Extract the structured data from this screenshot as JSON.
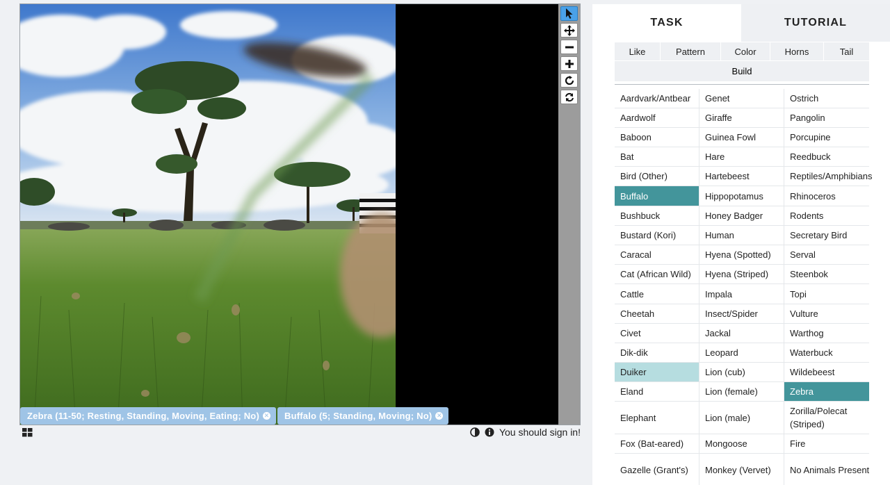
{
  "tags": [
    {
      "label": "Zebra (11-50; Resting, Standing, Moving, Eating; No)"
    },
    {
      "label": "Buffalo (5; Standing, Moving; No)"
    }
  ],
  "status": {
    "sign_in": "You should sign in!"
  },
  "tabs": {
    "task": "TASK",
    "tutorial": "TUTORIAL"
  },
  "filters": {
    "like": "Like",
    "pattern": "Pattern",
    "color": "Color",
    "horns": "Horns",
    "tail": "Tail",
    "build": "Build"
  },
  "species_rows": [
    [
      "Aardvark/Antbear",
      "Genet",
      "Ostrich"
    ],
    [
      "Aardwolf",
      "Giraffe",
      "Pangolin"
    ],
    [
      "Baboon",
      "Guinea Fowl",
      "Porcupine"
    ],
    [
      "Bat",
      "Hare",
      "Reedbuck"
    ],
    [
      "Bird (Other)",
      "Hartebeest",
      "Reptiles/Amphibians"
    ],
    [
      "Buffalo",
      "Hippopotamus",
      "Rhinoceros"
    ],
    [
      "Bushbuck",
      "Honey Badger",
      "Rodents"
    ],
    [
      "Bustard (Kori)",
      "Human",
      "Secretary Bird"
    ],
    [
      "Caracal",
      "Hyena (Spotted)",
      "Serval"
    ],
    [
      "Cat (African Wild)",
      "Hyena (Striped)",
      "Steenbok"
    ],
    [
      "Cattle",
      "Impala",
      "Topi"
    ],
    [
      "Cheetah",
      "Insect/Spider",
      "Vulture"
    ],
    [
      "Civet",
      "Jackal",
      "Warthog"
    ],
    [
      "Dik-dik",
      "Leopard",
      "Waterbuck"
    ],
    [
      "Duiker",
      "Lion (cub)",
      "Wildebeest"
    ],
    [
      "Eland",
      "Lion (female)",
      "Zebra"
    ],
    [
      "Elephant",
      "Lion (male)",
      "Zorilla/Polecat (Striped)"
    ],
    [
      "Fox (Bat-eared)",
      "Mongoose",
      "Fire"
    ],
    [
      "Gazelle (Grant's)",
      "Monkey (Vervet)",
      "No Animals Present"
    ]
  ],
  "selected_species": [
    "Buffalo",
    "Zebra"
  ],
  "highlighted_species": [
    "Duiker"
  ],
  "colors": {
    "selected": "#43959b",
    "hover": "#b6dde0",
    "tag": "#9fc4e6",
    "active_tool": "#4aa1e8"
  }
}
